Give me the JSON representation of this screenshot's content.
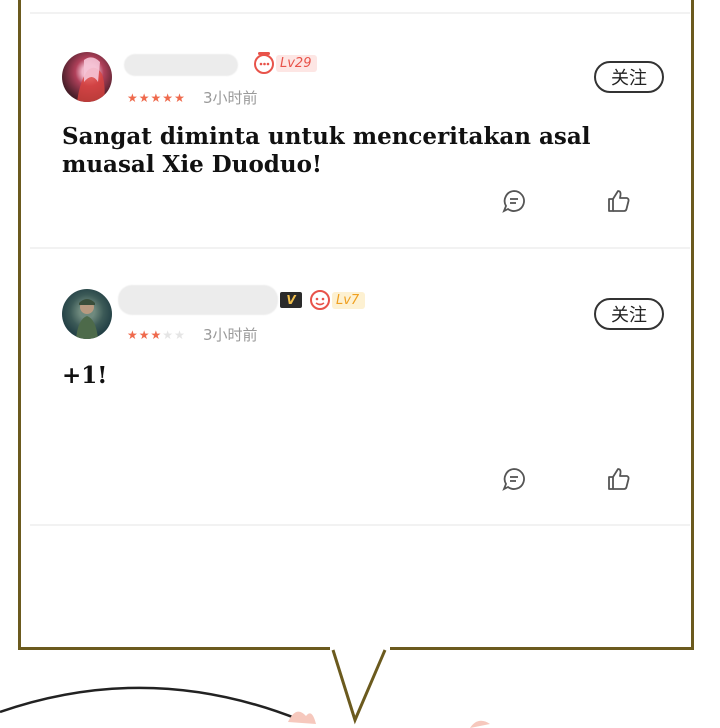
{
  "comments": [
    {
      "level": "Lv29",
      "stars_on": 5,
      "stars_total": 5,
      "time": "3小时前",
      "follow_label": "关注",
      "text": "Sangat diminta untuk menceritakan asal muasal Xie Duoduo!",
      "has_vip": false,
      "level_color": "#e8534a"
    },
    {
      "level": "Lv7",
      "stars_on": 3,
      "stars_total": 5,
      "time": "3小时前",
      "follow_label": "关注",
      "text": "+1!",
      "has_vip": true,
      "vip_label": "V",
      "level_color": "#f0a020"
    }
  ],
  "colors": {
    "bubble_border": "#6b5a1e",
    "star": "#ef6a4d"
  }
}
